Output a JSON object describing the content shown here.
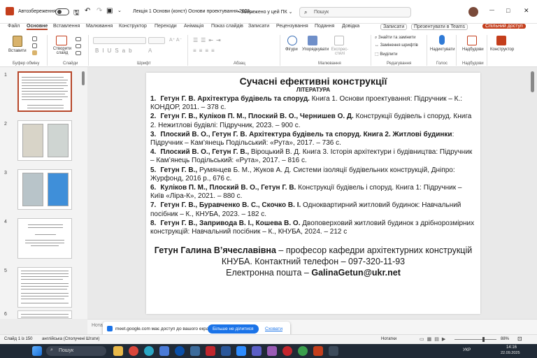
{
  "titlebar": {
    "autosave_label": "Автозбереження",
    "doc_title": "Лекція 1 Основи (конст) Основи проектування 2025...",
    "save_state": "• Збережено у цей ПК ⌄",
    "search_placeholder": "Пошук",
    "window_min": "—",
    "window_max": "□",
    "window_close": "✕"
  },
  "tabs": [
    "Файл",
    "Основне",
    "Вставлення",
    "Малювання",
    "Конструктор",
    "Переходи",
    "Анімація",
    "Показ слайдів",
    "Записати",
    "Рецензування",
    "Подання",
    "Довідка"
  ],
  "tab_actions": {
    "record": "Записати",
    "present_teams": "Презентувати в Teams",
    "share": "Спільний доступ"
  },
  "ribbon": {
    "paste": "Вставити",
    "new_slide": "Створити слайд",
    "clipboard_group": "Буфер обміну",
    "slides_group": "Слайди",
    "font_group": "Шрифт",
    "paragraph_group": "Абзац",
    "drawing_group": "Малювання",
    "editing_group": "Редагування",
    "voice_group": "Голос",
    "addins_group": "Надбудови",
    "shapes": "Фігури",
    "arrange": "Упорядкувати",
    "quick_styles": "Експрес-стилі",
    "find": "Знайти та замінити",
    "replace": "Замінення шрифтів",
    "select": "Виділити",
    "dictate": "Надиктувати",
    "addins": "Надбудови",
    "designer": "Конструктор"
  },
  "thumbnails": [
    {
      "num": "1",
      "selected": true
    },
    {
      "num": "2",
      "selected": false
    },
    {
      "num": "3",
      "selected": false
    },
    {
      "num": "4",
      "selected": false
    },
    {
      "num": "5",
      "selected": false
    },
    {
      "num": "6",
      "selected": false
    }
  ],
  "slide": {
    "title": "Сучасні ефективні конструкції",
    "subtitle": "ЛІТЕРАТУРА",
    "refs": [
      {
        "n": "1.",
        "authors": "Гетун Г. В. Архітектура будівель та споруд.",
        "rest": " Книга 1. Основи проектування: Підручник – К.: КОНДОР, 2011. – 378 с."
      },
      {
        "n": "2.",
        "authors": "Гетун Г. В., Куліков П. М., Плоский В. О., Чернишев О. Д.",
        "rest": " Конструкції будівель і споруд. Книга 2. Нежитлові будівлі: Підручник, 2023. – 900 с."
      },
      {
        "n": "3.",
        "authors": "Плоский В. О., Гетун Г. В. Архітектура будівель та споруд. Книга 2. Житлові будинки",
        "rest": ": Підручник – Кам’янець Подільський: «Рута», 2017. – 736 с."
      },
      {
        "n": "4.",
        "authors": "Плоский В. О., Гетун Г. В.,",
        "rest": " Віроцький В. Д. Книга 3. Історія архітектури і будівництва: Підручник – Кам’янець Подільський: «Рута», 2017. – 816 с."
      },
      {
        "n": "5.",
        "authors": "Гетун Г. В.,",
        "rest": " Румянцев Б. М., Жуков А. Д. Системи ізоляції будівельних конструкцій, Дніпро: Журфонд, 2016 р., 676 с."
      },
      {
        "n": "6.",
        "authors": "Куліков П. М., Плоский В. О., Гетун Г. В.",
        "rest": " Конструкції будівель і споруд. Книга 1: Підручник – Київ «Ліра-К», 2021. – 880 с."
      },
      {
        "n": "7.",
        "authors": "Гетун Г. В., Буравченко В. С., Скочко В. І.",
        "rest": " Одноквартирний житловий будинок: Навчальний посібник – К., КНУБА, 2023. – 182 с."
      },
      {
        "n": "8.",
        "authors": "Гетун Г. В., Запривода В. І., Кошева В. О.",
        "rest": " Двоповерховий житловий будинок з дрібнорозмірних конструкцій: Навчальний посібник – К., КНУБА, 2024. – 212 с"
      }
    ],
    "contact_name": "Гетун Галина В’ячеславівна",
    "contact_rest": " – професор кафедри архітектурних конструкцій КНУБА. Контактний телефон – 097-320-11-93",
    "email_label": "Електронна пошта – ",
    "email": "GalinaGetun@ukr.net"
  },
  "notes_placeholder": "Нотатки",
  "meet_banner": {
    "text": "meet.google.com має доступ до вашого екрана.",
    "stop": "Більше не ділитися",
    "hide": "Сховати"
  },
  "status": {
    "slide_of": "Слайд 1 із 150",
    "language": "англійська (Сполучені Штати)",
    "notes": "Нотатки",
    "zoom": "88%"
  },
  "taskbar": {
    "search": "Пошук",
    "lang": "УКР",
    "time": "14:16",
    "date": "22.09.2025"
  },
  "colors": {
    "accent": "#b7472a",
    "taskbar": "#202a36"
  }
}
